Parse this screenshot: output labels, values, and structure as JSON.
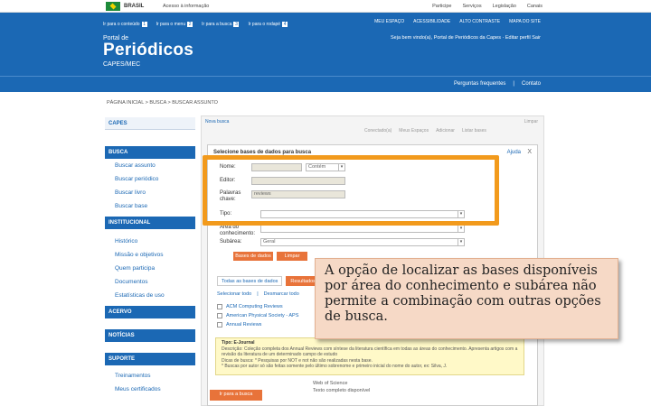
{
  "govbar": {
    "brasil": "BRASIL",
    "links": [
      "Acesso à informação"
    ],
    "right": [
      "Participe",
      "Serviços",
      "Legislação",
      "Canais"
    ]
  },
  "header": {
    "skip": [
      {
        "label": "Ir para o conteúdo",
        "key": "1"
      },
      {
        "label": "Ir para o menu",
        "key": "2"
      },
      {
        "label": "Ir para a busca",
        "key": "3"
      },
      {
        "label": "Ir para o rodapé",
        "key": "4"
      }
    ],
    "access": [
      "MEU ESPAÇO",
      "ACESSIBILIDADE",
      "ALTO CONTRASTE",
      "MAPA DO SITE"
    ],
    "portal_de": "Portal de",
    "title": "Periódicos",
    "subtitle": "CAPES/MEC",
    "welcome": "Seja bem vindo(a), Portal de Periódicos da Capes · Editar perfil Sair",
    "subnav": [
      "Perguntas frequentes",
      "Contato"
    ]
  },
  "breadcrumb": "PÁGINA INICIAL > BUSCA > BUSCAR ASSUNTO",
  "sidebar": {
    "capes": "CAPES",
    "busca": "BUSCA",
    "busca_items": [
      "Buscar assunto",
      "Buscar periódico",
      "Buscar livro",
      "Buscar base"
    ],
    "institucional": "INSTITUCIONAL",
    "inst_items": [
      "Histórico",
      "Missão e objetivos",
      "Quem participa",
      "Documentos",
      "Estatísticas de uso"
    ],
    "acervo": "ACERVO",
    "noticias": "NOTÍCIAS",
    "suporte": "SUPORTE",
    "suporte_items": [
      "Treinamentos",
      "Meus certificados"
    ]
  },
  "content": {
    "topline": "Nova busca",
    "topline_right": "Limpar",
    "tabs": [
      "Conectado(a)",
      "Meus Espaços",
      "Adicionar",
      "Listar bases"
    ],
    "dialog_title": "Selecione bases de dados para busca",
    "dialog_help": "Ajuda",
    "dialog_close": "X",
    "nome_label": "Nome:",
    "contem": "Contém",
    "editor_label": "Editor:",
    "keywords_label": "Palavras chave:",
    "keywords_value": "reviews",
    "tipo_label": "Tipo:",
    "area_label": "Área do conhecimento:",
    "subarea_label": "Subárea:",
    "subarea_value": "Geral",
    "btn_bases": "Bases de dados",
    "btn_limpar": "Limpar",
    "tab_all": "Todas as bases de dados",
    "tab_results": "Resultados",
    "select_all": "Selecionar todo",
    "deselect_all": "Desmarcar todo",
    "dbs": [
      "ACM Computing Reviews",
      "American Physical Society - APS",
      "Annual Reviews"
    ],
    "info_tipo": "Tipo: E-Journal",
    "info_desc": "Descrição: Coleção completa dos Annual Reviews com síntese da literatura científica em todas as áreas do conhecimento. Apresenta artigos com a revisão da literatura de um determinado campo de estudo",
    "info_dicas": "Dicas de busca: * Pesquisas por NOT e not não são realizadas nesta base.",
    "info_extra": "* Buscas por autor só são feitas somente pelo último sobrenome e primeiro inicial do nome do autor, ex: Silva, J.",
    "btn_bottom": "Ir para a busca",
    "bottom_right": [
      "Web of Science",
      "Texto completo disponível"
    ]
  },
  "callout": "A opção de localizar as bases disponíveis por área do conhecimento e subárea não permite a combinação com outras opções de busca."
}
